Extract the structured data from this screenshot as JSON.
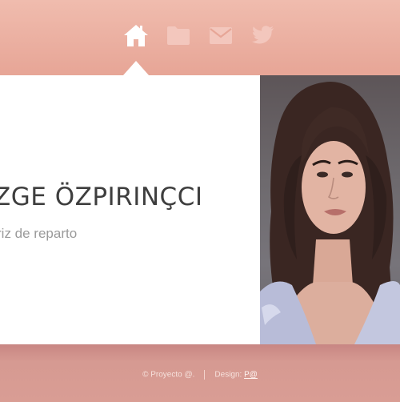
{
  "nav": {
    "items": [
      {
        "icon": "home-icon",
        "active": true
      },
      {
        "icon": "folder-icon",
        "active": false
      },
      {
        "icon": "envelope-icon",
        "active": false
      },
      {
        "icon": "twitter-icon",
        "active": false
      }
    ]
  },
  "profile": {
    "name": "ZGE ÖZPIRINÇCI",
    "role": "riz de reparto"
  },
  "footer": {
    "copyright": "© Proyecto @.",
    "design_label": "Design:",
    "design_link": "P@"
  },
  "colors": {
    "header_bg": "#e7a697",
    "footer_bg": "#d69a92",
    "card_bg": "#ffffff",
    "active_icon": "#ffffff",
    "inactive_icon": "#f3c7bd"
  }
}
